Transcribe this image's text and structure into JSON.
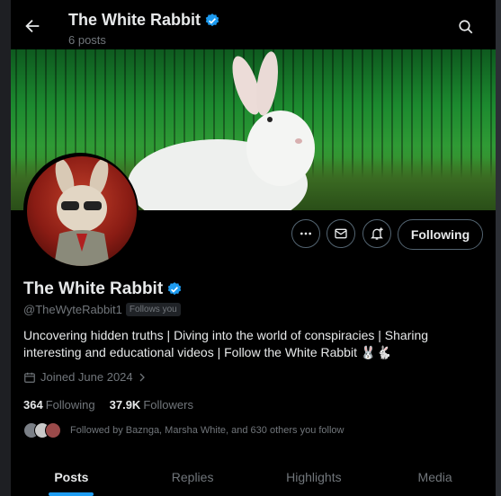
{
  "header": {
    "title": "The White Rabbit",
    "posts_count": "6 posts"
  },
  "actions": {
    "following_label": "Following"
  },
  "profile": {
    "name": "The White Rabbit",
    "handle": "@TheWyteRabbit1",
    "follows_you": "Follows you",
    "bio": "Uncovering hidden truths | Diving into the world of conspiracies |  Sharing interesting and educational videos | Follow the White Rabbit 🐰🐇",
    "joined": "Joined June 2024",
    "following_count": "364",
    "following_label": "Following",
    "followers_count": "37.9K",
    "followers_label": "Followers",
    "followed_by": "Followed by Baznga, Marsha White, and 630 others you follow"
  },
  "tabs": [
    {
      "label": "Posts",
      "active": true
    },
    {
      "label": "Replies",
      "active": false
    },
    {
      "label": "Highlights",
      "active": false
    },
    {
      "label": "Media",
      "active": false
    }
  ],
  "icons": [
    "back-arrow-icon",
    "verified-badge-icon",
    "search-icon",
    "more-icon",
    "message-icon",
    "notify-icon",
    "calendar-icon",
    "chevron-right-icon"
  ],
  "colors": {
    "accent": "#1d9bf0",
    "background": "#000000",
    "muted": "#71767b"
  }
}
